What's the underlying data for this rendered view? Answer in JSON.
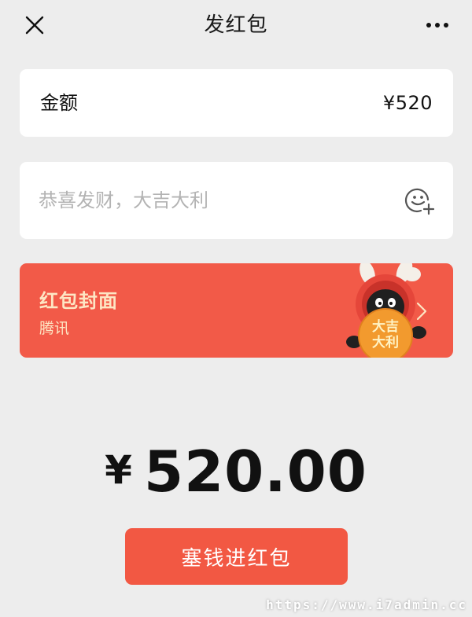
{
  "topbar": {
    "title": "发红包",
    "close_icon": "close-icon",
    "more_icon": "more-dots-icon"
  },
  "amount": {
    "label": "金额",
    "value": "¥520"
  },
  "message": {
    "placeholder": "恭喜发财，大吉大利",
    "value": "",
    "emoji_icon": "emoji-add-icon"
  },
  "cover": {
    "title": "红包封面",
    "subtitle": "腾讯",
    "mascot_text": "大吉大利",
    "chevron_icon": "chevron-right-icon"
  },
  "total": {
    "currency": "¥",
    "value": "520.00"
  },
  "send_button": {
    "label": "塞钱进红包"
  },
  "watermark": {
    "text": "https://www.i7admin.cc"
  },
  "colors": {
    "background": "#ededed",
    "accent_red": "#f25843",
    "cover_text": "#fde6c4"
  }
}
